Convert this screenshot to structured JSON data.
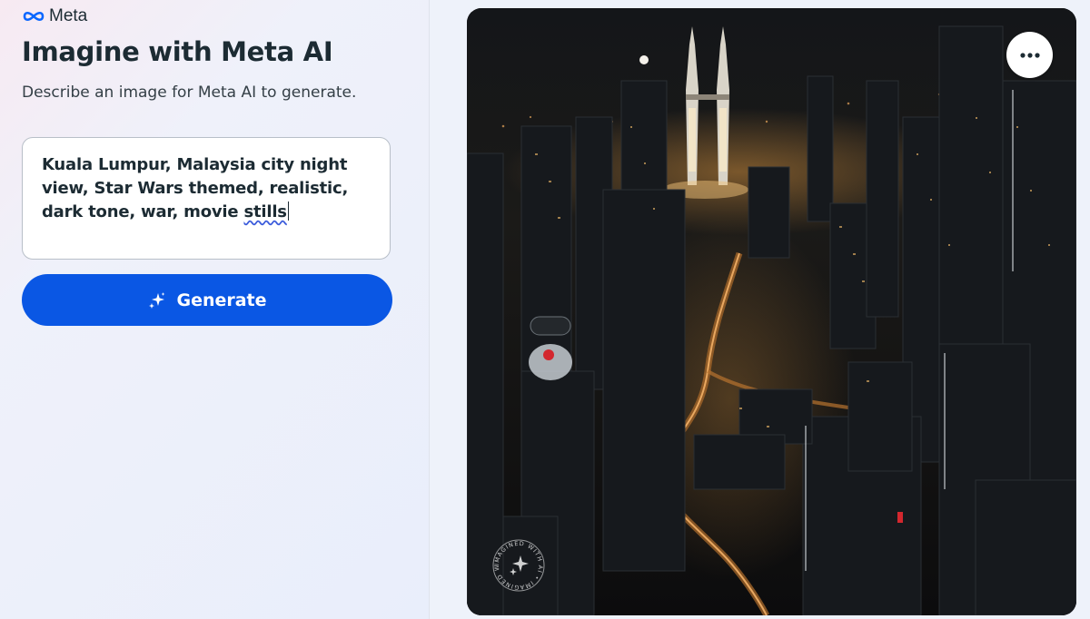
{
  "brand": {
    "name": "Meta",
    "icon": "meta-infinity-icon",
    "color": "#0866ff"
  },
  "header": {
    "title": "Imagine with Meta AI",
    "subtitle": "Describe an image for Meta AI to generate."
  },
  "prompt": {
    "value": "Kuala Lumpur, Malaysia city night view, Star Wars themed, realistic, dark tone, war, movie stills",
    "underlined_word": "stills"
  },
  "generate": {
    "label": "Generate",
    "icon": "sparkle-icon",
    "color": "#0a57e4"
  },
  "image": {
    "subject": "Kuala Lumpur city skyline at night with Petronas Twin Towers",
    "more_icon": "more-horizontal-icon",
    "watermark_text": "IMAGINED WITH AI",
    "watermark_icon": "sparkle-icon"
  }
}
